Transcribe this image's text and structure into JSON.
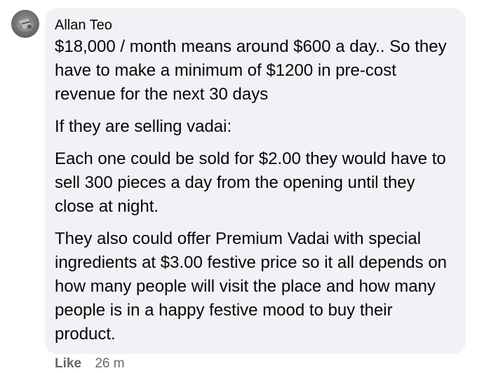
{
  "comment": {
    "author": "Allan Teo",
    "paragraphs": [
      "$18,000 / month means around $600 a day.. So they have to make a minimum of $1200 in pre-cost revenue for the next 30 days",
      "If they are selling vadai:",
      "Each one could be sold for $2.00 they would have to sell 300 pieces a day from the opening until they close at night.",
      "They also could offer Premium Vadai with special ingredients at $3.00 festive price so it all depends on how many people will visit the place and how many people is in a happy festive mood to buy their product."
    ],
    "actions": {
      "like_label": "Like",
      "timestamp": "26 m"
    }
  },
  "colors": {
    "bubble_background": "#f0f2f5",
    "text": "#050505",
    "secondary_text": "#65676b"
  }
}
